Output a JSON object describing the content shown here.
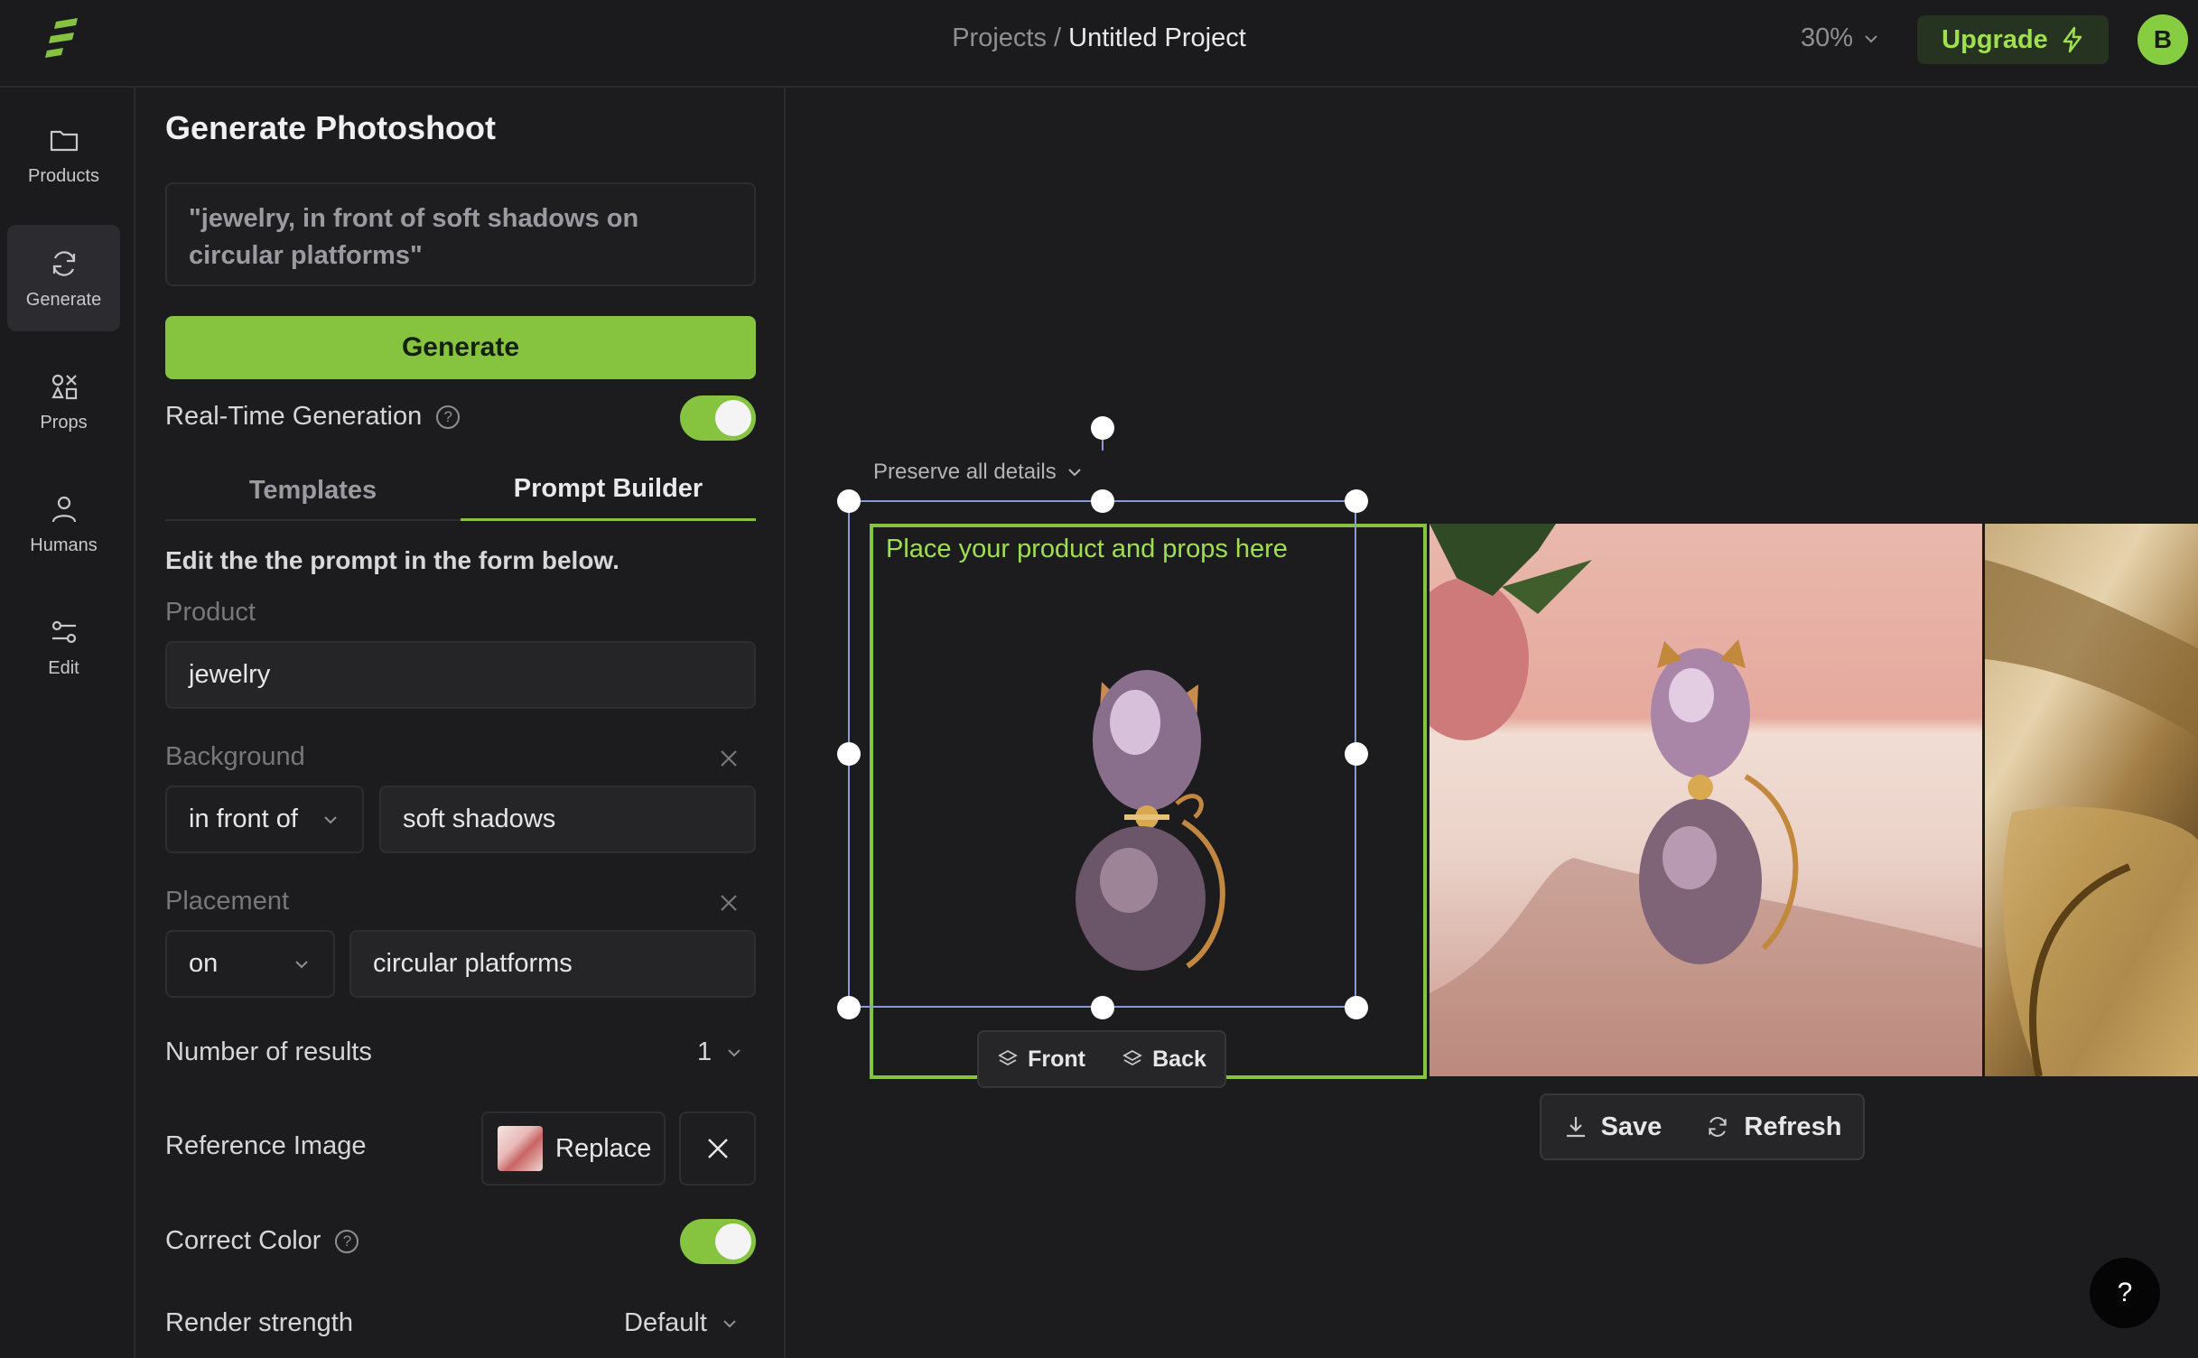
{
  "topbar": {
    "breadcrumb_parent": "Projects",
    "breadcrumb_separator": " / ",
    "breadcrumb_current": "Untitled Project",
    "zoom": "30%",
    "upgrade_label": "Upgrade",
    "avatar_initial": "B"
  },
  "rail": {
    "items": [
      {
        "label": "Products",
        "icon": "folder-icon"
      },
      {
        "label": "Generate",
        "icon": "refresh-icon",
        "active": true
      },
      {
        "label": "Props",
        "icon": "shapes-icon"
      },
      {
        "label": "Humans",
        "icon": "person-icon"
      },
      {
        "label": "Edit",
        "icon": "sliders-icon"
      }
    ]
  },
  "panel": {
    "title": "Generate Photoshoot",
    "prompt_text": "\"jewelry, in front of soft shadows on circular platforms\"",
    "generate_label": "Generate",
    "realtime_label": "Real-Time Generation",
    "realtime_on": true,
    "tabs": [
      {
        "label": "Templates",
        "active": false
      },
      {
        "label": "Prompt Builder",
        "active": true
      }
    ],
    "edit_hint": "Edit the the prompt in the form below.",
    "product": {
      "label": "Product",
      "value": "jewelry"
    },
    "background": {
      "label": "Background",
      "relation": "in front of",
      "value": "soft shadows"
    },
    "placement": {
      "label": "Placement",
      "relation": "on",
      "value": "circular platforms"
    },
    "results": {
      "label": "Number of results",
      "value": "1"
    },
    "reference": {
      "label": "Reference Image",
      "replace_label": "Replace"
    },
    "correct_color": {
      "label": "Correct Color",
      "on": true
    },
    "render_strength": {
      "label": "Render strength",
      "value": "Default"
    }
  },
  "canvas": {
    "preserve_label": "Preserve all details",
    "frame_hint": "Place your product and props here",
    "front_label": "Front",
    "back_label": "Back",
    "save_label": "Save",
    "refresh_label": "Refresh",
    "help_label": "?"
  },
  "colors": {
    "accent": "#86c440",
    "background": "#1c1c1e",
    "selection": "#8a9ad8"
  }
}
